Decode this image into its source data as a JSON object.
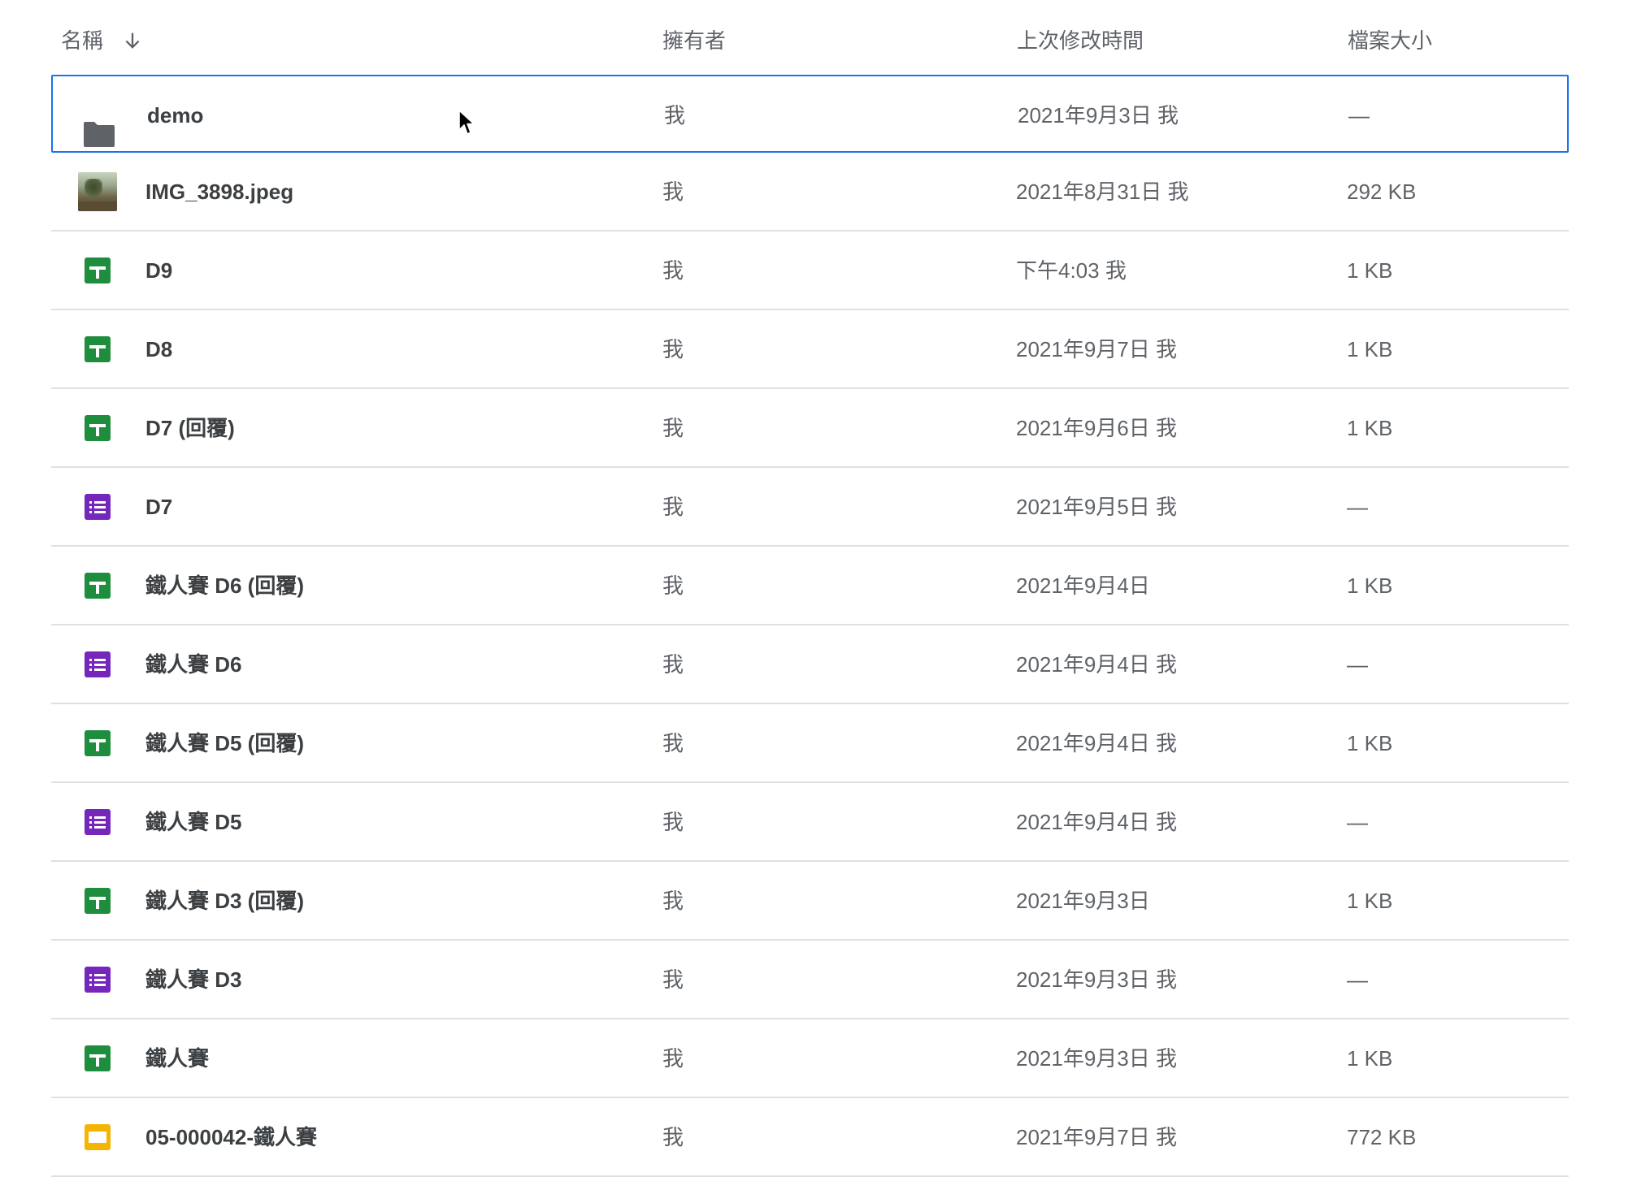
{
  "columns": {
    "name": "名稱",
    "owner": "擁有者",
    "modified": "上次修改時間",
    "size": "檔案大小"
  },
  "sort_icon": "arrow-down-icon",
  "colors": {
    "selected_border": "#1a73e8",
    "sheets": "#1e8e3e",
    "forms": "#7627bb",
    "slides": "#f4b400",
    "folder": "#5f6368"
  },
  "files": [
    {
      "icon": "folder-icon",
      "name": "demo",
      "owner": "我",
      "modified": "2021年9月3日 我",
      "size": "—",
      "selected": true
    },
    {
      "icon": "image-thumbnail-icon",
      "name": "IMG_3898.jpeg",
      "owner": "我",
      "modified": "2021年8月31日 我",
      "size": "292 KB"
    },
    {
      "icon": "google-sheets-icon",
      "name": "D9",
      "owner": "我",
      "modified": "下午4:03 我",
      "size": "1 KB"
    },
    {
      "icon": "google-sheets-icon",
      "name": "D8",
      "owner": "我",
      "modified": "2021年9月7日 我",
      "size": "1 KB"
    },
    {
      "icon": "google-sheets-icon",
      "name": "D7 (回覆)",
      "owner": "我",
      "modified": "2021年9月6日 我",
      "size": "1 KB"
    },
    {
      "icon": "google-forms-icon",
      "name": "D7",
      "owner": "我",
      "modified": "2021年9月5日 我",
      "size": "—"
    },
    {
      "icon": "google-sheets-icon",
      "name": "鐵人賽 D6 (回覆)",
      "owner": "我",
      "modified": "2021年9月4日",
      "size": "1 KB"
    },
    {
      "icon": "google-forms-icon",
      "name": "鐵人賽 D6",
      "owner": "我",
      "modified": "2021年9月4日 我",
      "size": "—"
    },
    {
      "icon": "google-sheets-icon",
      "name": "鐵人賽 D5 (回覆)",
      "owner": "我",
      "modified": "2021年9月4日 我",
      "size": "1 KB"
    },
    {
      "icon": "google-forms-icon",
      "name": "鐵人賽 D5",
      "owner": "我",
      "modified": "2021年9月4日 我",
      "size": "—"
    },
    {
      "icon": "google-sheets-icon",
      "name": "鐵人賽 D3 (回覆)",
      "owner": "我",
      "modified": "2021年9月3日",
      "size": "1 KB"
    },
    {
      "icon": "google-forms-icon",
      "name": "鐵人賽 D3",
      "owner": "我",
      "modified": "2021年9月3日 我",
      "size": "—"
    },
    {
      "icon": "google-sheets-icon",
      "name": "鐵人賽",
      "owner": "我",
      "modified": "2021年9月3日 我",
      "size": "1 KB"
    },
    {
      "icon": "google-slides-icon",
      "name": "05-000042-鐵人賽",
      "owner": "我",
      "modified": "2021年9月7日 我",
      "size": "772 KB"
    }
  ]
}
